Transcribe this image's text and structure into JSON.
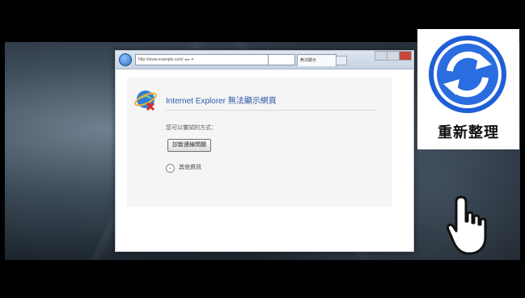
{
  "browser": {
    "address": "http://www.example.com/ ◂ ▸ ✕",
    "tab_label": "無法顯示",
    "error_headline": "Internet Explorer 無法顯示網頁",
    "hint_text": "您可以嘗試的方式：",
    "diagnose_button": "診斷連線問題",
    "more_info": "其他資訊"
  },
  "overlay": {
    "refresh_label": "重新整理"
  },
  "icons": {
    "ie": "internet-explorer-error-icon",
    "refresh": "refresh-icon",
    "cursor": "hand-pointer-cursor"
  },
  "colors": {
    "ie_link_blue": "#2e5aa8",
    "refresh_blue": "#1f5fd6"
  }
}
